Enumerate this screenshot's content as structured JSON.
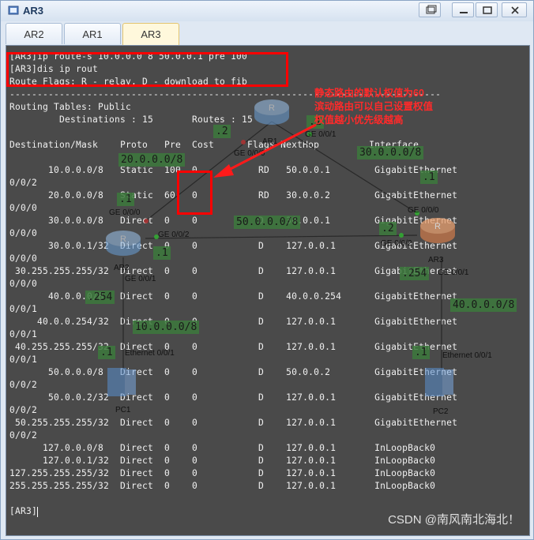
{
  "window": {
    "title": "AR3",
    "tabs": [
      {
        "label": "AR2",
        "active": false
      },
      {
        "label": "AR1",
        "active": false
      },
      {
        "label": "AR3",
        "active": true
      }
    ]
  },
  "terminal": {
    "lines": [
      "[AR3]ip route-s 10.0.0.0 8 50.0.0.1 pre 100",
      "[AR3]dis ip rout",
      "Route Flags: R - relay, D - download to fib",
      "------------------------------------------------------------------------------",
      "Routing Tables: Public",
      "         Destinations : 15       Routes : 15",
      "",
      "Destination/Mask    Proto   Pre  Cost      Flags NextHop         Interface",
      "",
      "       10.0.0.0/8   Static  100  0           RD   50.0.0.1        GigabitEthernet",
      "0/0/2",
      "       20.0.0.0/8   Static  60   0           RD   30.0.0.2        GigabitEthernet",
      "0/0/0",
      "       30.0.0.0/8   Direct  0    0           D    30.0.0.1        GigabitEthernet",
      "0/0/0",
      "       30.0.0.1/32  Direct  0    0           D    127.0.0.1       GigabitEthernet",
      "0/0/0",
      " 30.255.255.255/32  Direct  0    0           D    127.0.0.1       GigabitEthernet",
      "0/0/0",
      "       40.0.0.0/8   Direct  0    0           D    40.0.0.254      GigabitEthernet",
      "0/0/1",
      "     40.0.0.254/32  Direct  0    0           D    127.0.0.1       GigabitEthernet",
      "0/0/1",
      " 40.255.255.255/32  Direct  0    0           D    127.0.0.1       GigabitEthernet",
      "0/0/1",
      "       50.0.0.0/8   Direct  0    0           D    50.0.0.2        GigabitEthernet",
      "0/0/2",
      "       50.0.0.2/32  Direct  0    0           D    127.0.0.1       GigabitEthernet",
      "0/0/2",
      " 50.255.255.255/32  Direct  0    0           D    127.0.0.1       GigabitEthernet",
      "0/0/2",
      "      127.0.0.0/8   Direct  0    0           D    127.0.0.1       InLoopBack0",
      "      127.0.0.1/32  Direct  0    0           D    127.0.0.1       InLoopBack0",
      "127.255.255.255/32  Direct  0    0           D    127.0.0.1       InLoopBack0",
      "255.255.255.255/32  Direct  0    0           D    127.0.0.1       InLoopBack0",
      "",
      "[AR3]"
    ]
  },
  "annotation": {
    "line1": "静态路由的默认权值为60",
    "line2": "滨动路由可以自己设置权值",
    "line3": "权值越小优先级越高"
  },
  "topology": {
    "devices": [
      "AR1",
      "AR2",
      "AR3",
      "PC1",
      "PC2"
    ],
    "interfaces": [
      "GE 0/0/0",
      "GE 0/0/1",
      "GE 0/0/0",
      "GE 0/0/2",
      "GE 0/0/1",
      "GE 0/0/0",
      "GE 0/0/2",
      "GE 0/0/1",
      "Ethernet 0/0/1",
      "Ethernet 0/0/1"
    ],
    "networks": [
      "20.0.0.0/8",
      "30.0.0.0/8",
      "50.0.0.0/8",
      "10.0.0.0/8",
      "40.0.0.0/8"
    ],
    "host_ids": [
      ".2",
      ".1",
      ".1",
      ".2",
      ".1",
      ".1",
      ".254",
      ".254",
      ".1",
      ".1"
    ]
  },
  "watermark": "CSDN @南风南北海北！",
  "colors": {
    "terminal_bg": "#4a4a4a",
    "highlight": "#ff0000",
    "tag_bg": "#3c7a3c"
  }
}
